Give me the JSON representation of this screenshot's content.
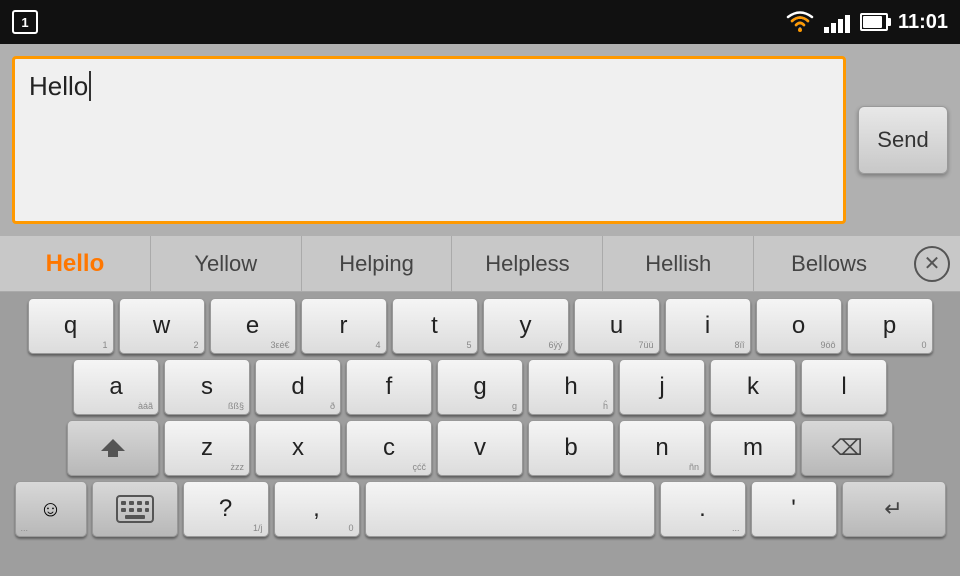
{
  "statusBar": {
    "notificationNumber": "1",
    "time": "11:01"
  },
  "inputArea": {
    "textValue": "Hello",
    "sendLabel": "Send"
  },
  "suggestions": {
    "items": [
      "Hello",
      "Yellow",
      "Helping",
      "Helpless",
      "Hellish",
      "Bellows"
    ],
    "activeIndex": 0
  },
  "keyboard": {
    "rows": [
      [
        {
          "main": "q",
          "sub": "1"
        },
        {
          "main": "w",
          "sub": "2"
        },
        {
          "main": "e",
          "sub": "3εé€"
        },
        {
          "main": "r",
          "sub": "4"
        },
        {
          "main": "t",
          "sub": "5"
        },
        {
          "main": "y",
          "sub": "6ÿý"
        },
        {
          "main": "u",
          "sub": "7üü"
        },
        {
          "main": "i",
          "sub": "8ïî"
        },
        {
          "main": "o",
          "sub": "9öô"
        },
        {
          "main": "p",
          "sub": "0"
        }
      ],
      [
        {
          "main": "a",
          "sub": "àáã"
        },
        {
          "main": "s",
          "sub": "ßß§"
        },
        {
          "main": "d",
          "sub": "ð"
        },
        {
          "main": "f",
          "sub": ""
        },
        {
          "main": "g",
          "sub": "g"
        },
        {
          "main": "h",
          "sub": "ĥ"
        },
        {
          "main": "j",
          "sub": ""
        },
        {
          "main": "k",
          "sub": ""
        },
        {
          "main": "l",
          "sub": ""
        }
      ],
      [
        {
          "main": "shift"
        },
        {
          "main": "z",
          "sub": "żzz"
        },
        {
          "main": "x",
          "sub": ""
        },
        {
          "main": "c",
          "sub": "çćč"
        },
        {
          "main": "v",
          "sub": ""
        },
        {
          "main": "b",
          "sub": ""
        },
        {
          "main": "n",
          "sub": "ñn"
        },
        {
          "main": "m",
          "sub": ""
        },
        {
          "main": "backspace"
        }
      ],
      [
        {
          "main": "emoji"
        },
        {
          "main": "keyboard"
        },
        {
          "main": "?",
          "sub": "1/j"
        },
        {
          "main": ",",
          "sub": "0"
        },
        {
          "main": "space"
        },
        {
          "main": ".",
          "sub": "..."
        },
        {
          "main": "'",
          "sub": ""
        },
        {
          "main": "enter"
        }
      ]
    ]
  }
}
